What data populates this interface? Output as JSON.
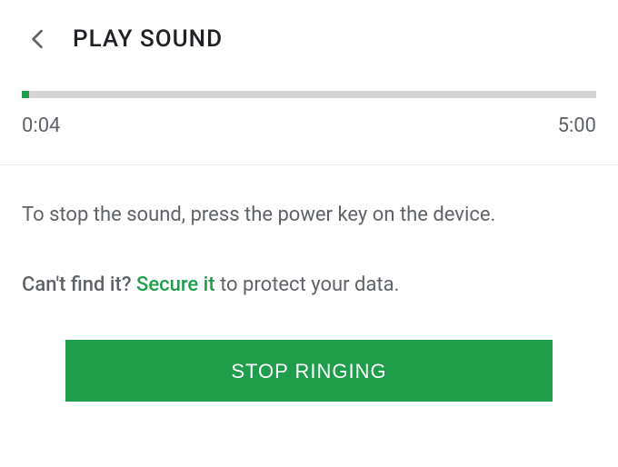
{
  "header": {
    "title": "PLAY SOUND"
  },
  "progress": {
    "elapsed": "0:04",
    "total": "5:00",
    "percent": 1.3
  },
  "instruction": "To stop the sound, press the power key on the device.",
  "hint": {
    "question": "Can't find it?",
    "link": "Secure it",
    "suffix": " to protect your data."
  },
  "button": {
    "label": "STOP RINGING"
  },
  "colors": {
    "accent": "#1e9e4a"
  }
}
